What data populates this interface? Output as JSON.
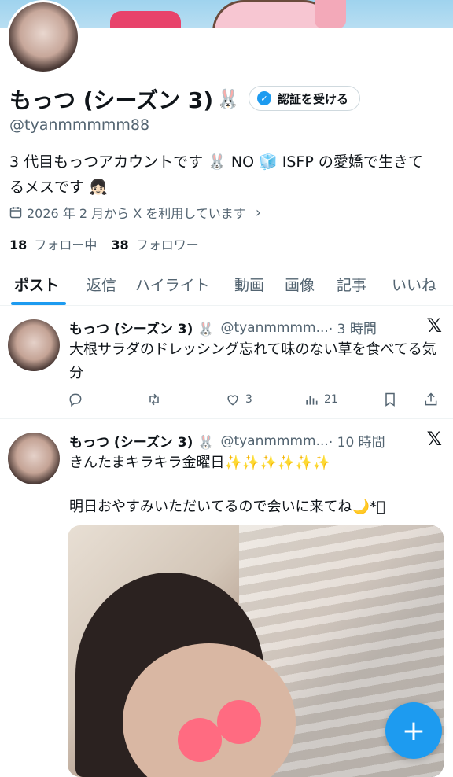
{
  "profile": {
    "display_name": "もっつ (シーズン 3)",
    "name_emoji": "🐰",
    "handle": "@tyanmmmmm88",
    "verify_label": "認証を受ける",
    "bio_line1": "3 代目もっつアカウントです 🐰 NO 🧊 ISFP の愛嬌で生きて",
    "bio_line2": "るメスです 👧🏻",
    "joined": "2026 年 2 月から X を利用しています",
    "following_count": "18",
    "following_label": "フォロー中",
    "followers_count": "38",
    "followers_label": "フォロワー"
  },
  "tabs": [
    "ポスト",
    "返信",
    "ハイライト",
    "動画",
    "画像",
    "記事",
    "いいね"
  ],
  "tweets": [
    {
      "name": "もっつ (シーズン 3) 🐰",
      "handle": "@tyanmmmm...",
      "time": "· 3 時間",
      "text": "大根サラダのドレッシング忘れて味のない草を食べてる気分",
      "likes": "3",
      "views": "21"
    },
    {
      "name": "もっつ (シーズン 3) 🐰",
      "handle": "@tyanmmmm...",
      "time": "· 10 時間",
      "text_line1": "きんたまキラキラ金曜日✨✨✨✨✨✨",
      "text_line2": "明日おやすみいただいてるので会いに来てね🌙*ﾟ"
    }
  ],
  "icons": {
    "x_logo": "𝕏",
    "fab": "+",
    "calendar": "calendar-icon",
    "reply": "reply-icon",
    "retweet": "retweet-icon",
    "like": "heart-icon",
    "views": "views-icon",
    "bookmark": "bookmark-icon",
    "share": "share-icon"
  },
  "colors": {
    "accent": "#1d9bf0",
    "muted": "#536471"
  }
}
